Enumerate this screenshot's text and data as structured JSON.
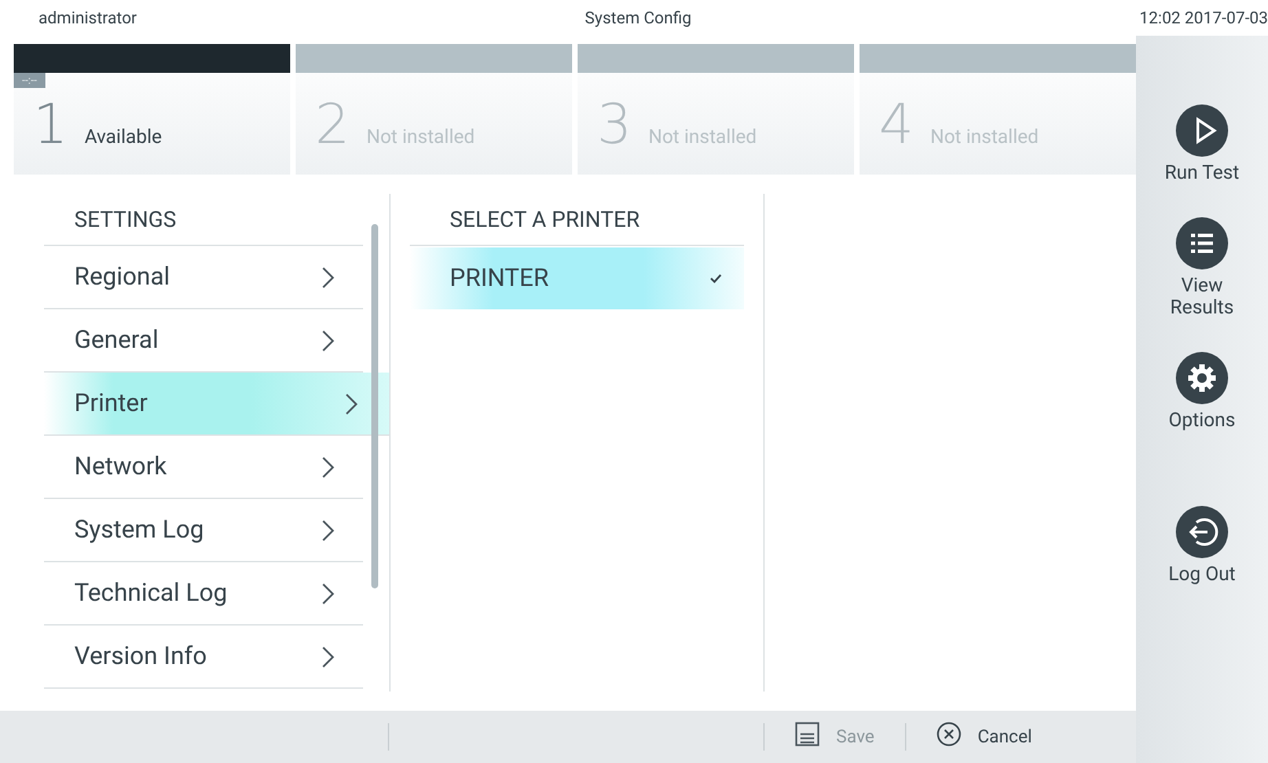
{
  "top_bar": {
    "user": "administrator",
    "title": "System Config",
    "clock": "12:02 2017-07-03"
  },
  "modules": [
    {
      "number": "1",
      "status": "Available",
      "timer": "--:--",
      "installed": true
    },
    {
      "number": "2",
      "status": "Not installed",
      "installed": false
    },
    {
      "number": "3",
      "status": "Not installed",
      "installed": false
    },
    {
      "number": "4",
      "status": "Not installed",
      "installed": false
    }
  ],
  "settings": {
    "heading": "SETTINGS",
    "items": [
      {
        "label": "Regional",
        "selected": false
      },
      {
        "label": "General",
        "selected": false
      },
      {
        "label": "Printer",
        "selected": true
      },
      {
        "label": "Network",
        "selected": false
      },
      {
        "label": "System Log",
        "selected": false
      },
      {
        "label": "Technical Log",
        "selected": false
      },
      {
        "label": "Version Info",
        "selected": false
      }
    ]
  },
  "printers": {
    "heading": "SELECT  A PRINTER",
    "items": [
      {
        "label": "PRINTER",
        "selected": true
      }
    ]
  },
  "side_nav": [
    {
      "kind": "run",
      "label": "Run Test"
    },
    {
      "kind": "results",
      "label": "View Results"
    },
    {
      "kind": "options",
      "label": "Options"
    },
    {
      "kind": "logout",
      "label": "Log Out"
    }
  ],
  "footer": {
    "save": "Save",
    "cancel": "Cancel",
    "save_disabled": true
  }
}
